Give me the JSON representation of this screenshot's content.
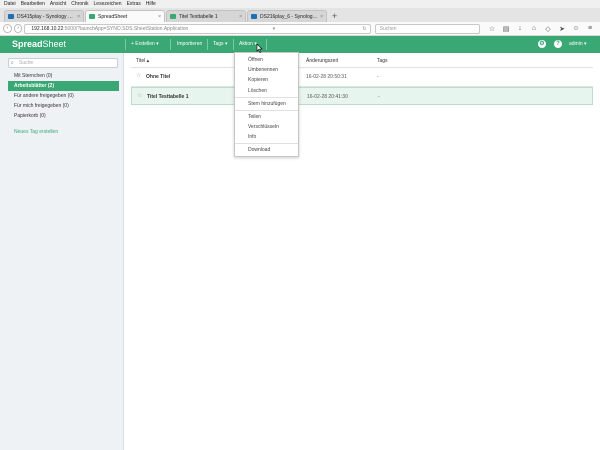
{
  "browser": {
    "menu": [
      "Datei",
      "Bearbeiten",
      "Ansicht",
      "Chronik",
      "Lesezeichen",
      "Extras",
      "Hilfe"
    ],
    "tabs": [
      {
        "title": "DS415play - Synology Disk...",
        "active": false
      },
      {
        "title": "SpreadSheet",
        "active": true
      },
      {
        "title": "Titel Testtabelle 1",
        "active": false
      },
      {
        "title": "DS216play_6 - Synology Di...",
        "active": false
      }
    ],
    "new_tab": "+",
    "close_glyph": "×",
    "url_host": "192.168.10.22",
    "url_path": ":5000/?launchApp=SYNO.SDS.SheetStation.Application",
    "search_placeholder": "Suchen",
    "nav": {
      "back": "‹",
      "forward": "›",
      "reload": "↻",
      "dropdown": "▾"
    },
    "toolbar_icons": {
      "bookmark": "☆",
      "library": "▤",
      "download": "↓",
      "home": "⌂",
      "pocket": "◇",
      "send": "➤",
      "chat": "☺",
      "menu": "≡"
    }
  },
  "app": {
    "brand_bold": "Spread",
    "brand_light": "Sheet",
    "create_label": "+ Erstellen",
    "create_caret": "▾",
    "import_label": "Importieren",
    "tags_label": "Tags",
    "tags_caret": "▾",
    "action_label": "Aktion",
    "action_caret": "▾",
    "user_label": "admin",
    "user_caret": "▾",
    "gear_glyph": "⚙",
    "help_glyph": "?"
  },
  "sidebar": {
    "search_placeholder": "Suche",
    "search_glyph": "⌕",
    "items": [
      {
        "label": "Mit Sternchen (0)",
        "active": false
      },
      {
        "label": "Arbeitsblätter (2)",
        "active": true
      },
      {
        "label": "Für andere freigegeben (0)",
        "active": false
      },
      {
        "label": "Für mich freigegeben (0)",
        "active": false
      },
      {
        "label": "Papierkorb (0)",
        "active": false
      }
    ],
    "new_tag": "Neues Tag erstellen"
  },
  "table": {
    "headers": {
      "title": "Titel ▴",
      "modified": "Änderungszeit",
      "tags": "Tags"
    },
    "star_glyph": "☆",
    "rows": [
      {
        "title": "Ohne Titel",
        "modified": "16-02-28 20:50:31",
        "tags": "-",
        "selected": false
      },
      {
        "title": "Titel Testtabelle 1",
        "modified": "16-02-28 20:41:30",
        "tags": "-",
        "selected": true
      }
    ]
  },
  "action_menu": {
    "items": [
      "Öffnen",
      "Umbenennen",
      "Kopieren",
      "Löschen",
      "Stern hinzufügen",
      "Teilen",
      "Verschlüsseln",
      "Info",
      "Download"
    ]
  },
  "colors": {
    "accent": "#3aa874",
    "sidebar_bg": "#eef2f5",
    "selected_row": "#e8f5ee"
  }
}
